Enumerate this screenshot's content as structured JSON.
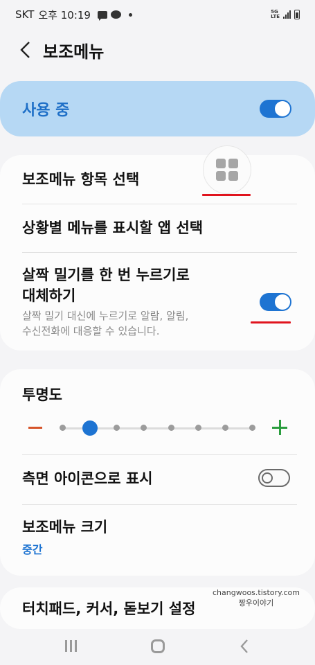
{
  "status_bar": {
    "carrier": "SKT",
    "time": "오후 10:19",
    "icons_left": [
      "message-icon",
      "kakaotalk-icon",
      "notification-dot-icon"
    ],
    "network_label": "5G LTE",
    "icons_right": [
      "network-icon",
      "signal-icon",
      "battery-icon"
    ]
  },
  "header": {
    "title": "보조메뉴",
    "back_icon": "chevron-left-icon"
  },
  "master_switch": {
    "label": "사용 중",
    "enabled": true
  },
  "settings_group_1": {
    "items": [
      {
        "title": "보조메뉴 항목 선택"
      },
      {
        "title": "상황별 메뉴를 표시할 앱 선택"
      },
      {
        "title_line1": "살짝 밀기를 한 번 누르기로",
        "title_line2": "대체하기",
        "desc_line1": "살짝 밀기 대신에 누르기로 알람, 알림,",
        "desc_line2": "수신전화에 대응할 수 있습니다.",
        "enabled": true
      }
    ]
  },
  "floating_menu_button": {
    "icon": "grid-icon"
  },
  "settings_group_2": {
    "transparency": {
      "title": "투명도",
      "level": 1,
      "steps": 8,
      "minus_icon": "minus-icon",
      "plus_icon": "plus-icon"
    },
    "side_icon": {
      "title": "측면 아이콘으로 표시",
      "enabled": false
    },
    "size": {
      "title": "보조메뉴 크기",
      "value": "중간"
    }
  },
  "settings_group_3": {
    "title": "터치패드, 커서, 돋보기 설정"
  },
  "watermark": {
    "line1": "changwoos.tistory.com",
    "line2": "짱우이야기"
  },
  "colors": {
    "accent": "#1e74d2",
    "master_card_bg": "#b6d8f4",
    "annotation_red": "#e0141e",
    "minus_orange": "#d6542a",
    "plus_green": "#2a9d3e"
  },
  "nav_bar": {
    "buttons": [
      "recents-icon",
      "home-icon",
      "back-icon"
    ]
  }
}
